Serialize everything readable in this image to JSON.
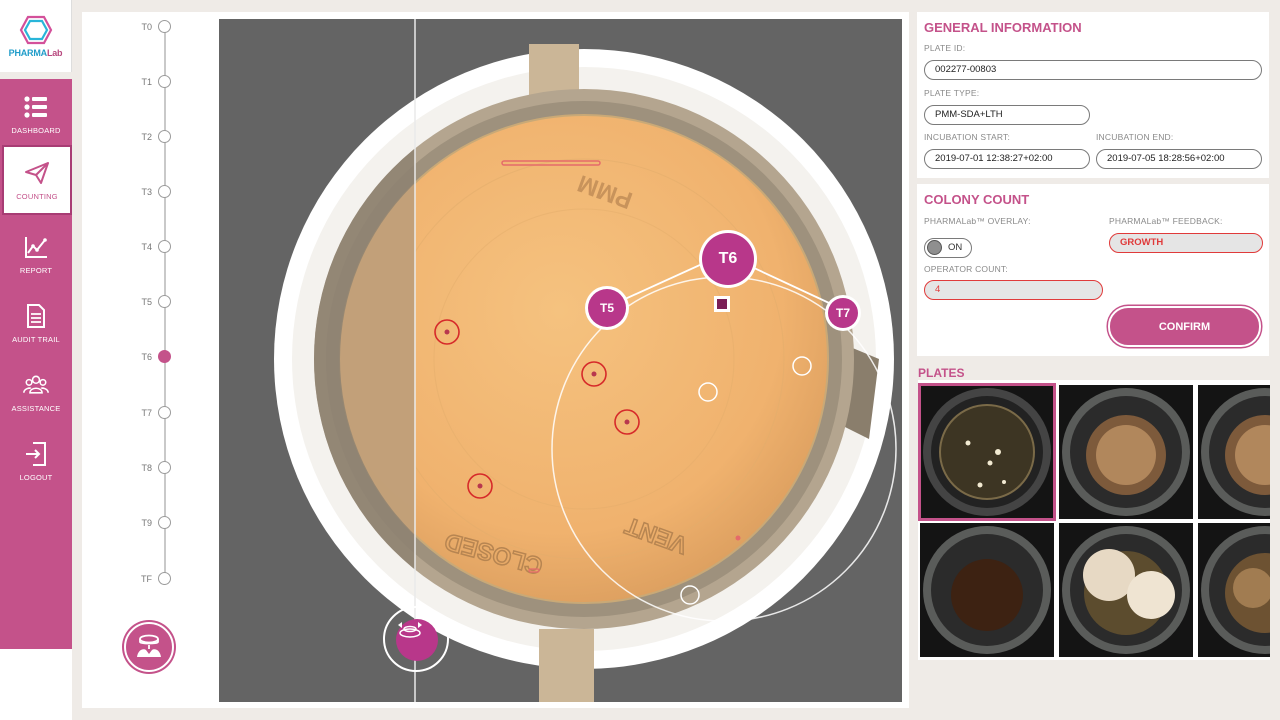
{
  "app": {
    "logo_text_a": "PHARMA",
    "logo_text_b": "Lab"
  },
  "nav": [
    {
      "label": "DASHBOARD",
      "icon": "list-icon"
    },
    {
      "label": "COUNTING",
      "icon": "paper-plane-icon",
      "active": true
    },
    {
      "label": "REPORT",
      "icon": "line-chart-icon"
    },
    {
      "label": "AUDIT TRAIL",
      "icon": "document-icon"
    },
    {
      "label": "ASSISTANCE",
      "icon": "group-icon"
    },
    {
      "label": "LOGOUT",
      "icon": "logout-icon"
    }
  ],
  "timeline": {
    "steps": [
      "T0",
      "T1",
      "T2",
      "T3",
      "T4",
      "T5",
      "T6",
      "T7",
      "T8",
      "T9",
      "TF"
    ],
    "current": "T6"
  },
  "viewer": {
    "nodes": [
      "T5",
      "T6",
      "T7"
    ],
    "plate_text_top": "PMM",
    "plate_text_vent": "VENT",
    "plate_text_closed": "CLOSED"
  },
  "general": {
    "title": "GENERAL INFORMATION",
    "plate_id_label": "PLATE ID:",
    "plate_id": "002277-00803",
    "plate_type_label": "PLATE TYPE:",
    "plate_type": "PMM-SDA+LTH",
    "inc_start_label": "INCUBATION START:",
    "inc_start": "2019-07-01 12:38:27+02:00",
    "inc_end_label": "INCUBATION END:",
    "inc_end": "2019-07-05 18:28:56+02:00"
  },
  "colony": {
    "title": "COLONY COUNT",
    "overlay_label": "PHARMALab™ OVERLAY:",
    "overlay_state": "ON",
    "feedback_label": "PHARMALab™ FEEDBACK:",
    "feedback": "GROWTH",
    "operator_label": "OPERATOR COUNT:",
    "operator_count": "4",
    "confirm_label": "CONFIRM"
  },
  "plates": {
    "title": "PLATES",
    "selected_index": 0
  },
  "colors": {
    "accent": "#c4528a",
    "accent_dark": "#a83c74",
    "alert": "#e03a3a",
    "viewer_bg": "#646464"
  }
}
